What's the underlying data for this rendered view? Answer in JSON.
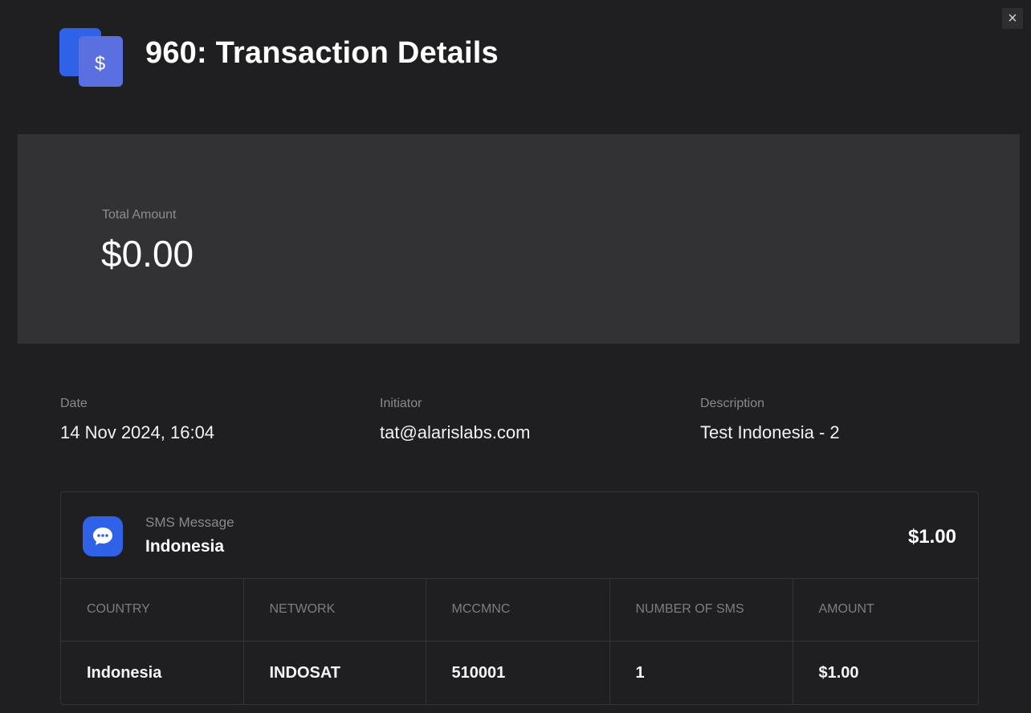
{
  "header": {
    "id": "960",
    "title": "960: Transaction Details",
    "icon": "document-dollar-icon",
    "currency_symbol": "$"
  },
  "close": {
    "label": "×",
    "icon": "close-icon"
  },
  "total": {
    "label": "Total Amount",
    "value": "$0.00"
  },
  "info": {
    "date": {
      "label": "Date",
      "value": "14 Nov 2024, 16:04"
    },
    "initiator": {
      "label": "Initiator",
      "value": "tat@alarislabs.com"
    },
    "description": {
      "label": "Description",
      "value": "Test Indonesia - 2"
    }
  },
  "sms": {
    "icon": "chat-bubble-icon",
    "type": "SMS Message",
    "country": "Indonesia",
    "amount": "$1.00",
    "table": {
      "columns": [
        "COUNTRY",
        "NETWORK",
        "MCCMNC",
        "NUMBER OF SMS",
        "AMOUNT"
      ],
      "rows": [
        [
          "Indonesia",
          "INDOSAT",
          "510001",
          "1",
          "$1.00"
        ]
      ]
    }
  },
  "colors": {
    "background": "#1f1f21",
    "panel": "#323235",
    "accent": "#2f62e6",
    "border": "#343437"
  }
}
